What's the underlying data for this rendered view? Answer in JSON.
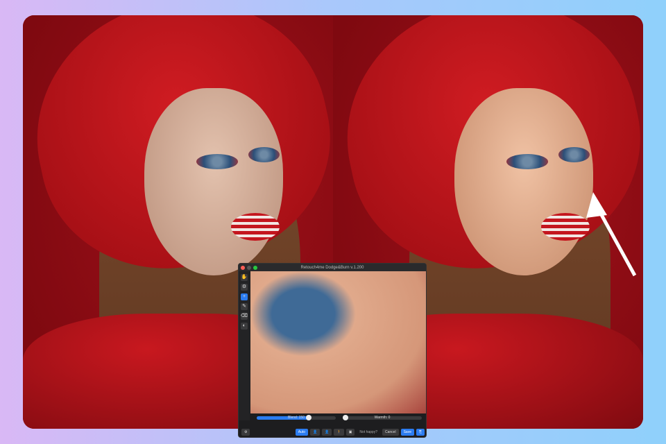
{
  "plugin": {
    "title": "Retouch4me Dodge&Burn v.1.200",
    "tools": [
      "hand-icon",
      "settings-icon",
      "plus-icon",
      "brush-icon",
      "eraser-icon",
      "contrast-icon"
    ],
    "blend_label": "Blend: 150",
    "blend_value": 150,
    "blend_fraction": 0.66,
    "warmth_label": "Warmth: 0",
    "warmth_value": 0,
    "auto_label": "Auto",
    "not_happy": "Not happy?",
    "cancel": "Cancel",
    "save": "Save"
  },
  "colors": {
    "accent": "#2b7cf0",
    "backdrop": "#8e0a10"
  }
}
